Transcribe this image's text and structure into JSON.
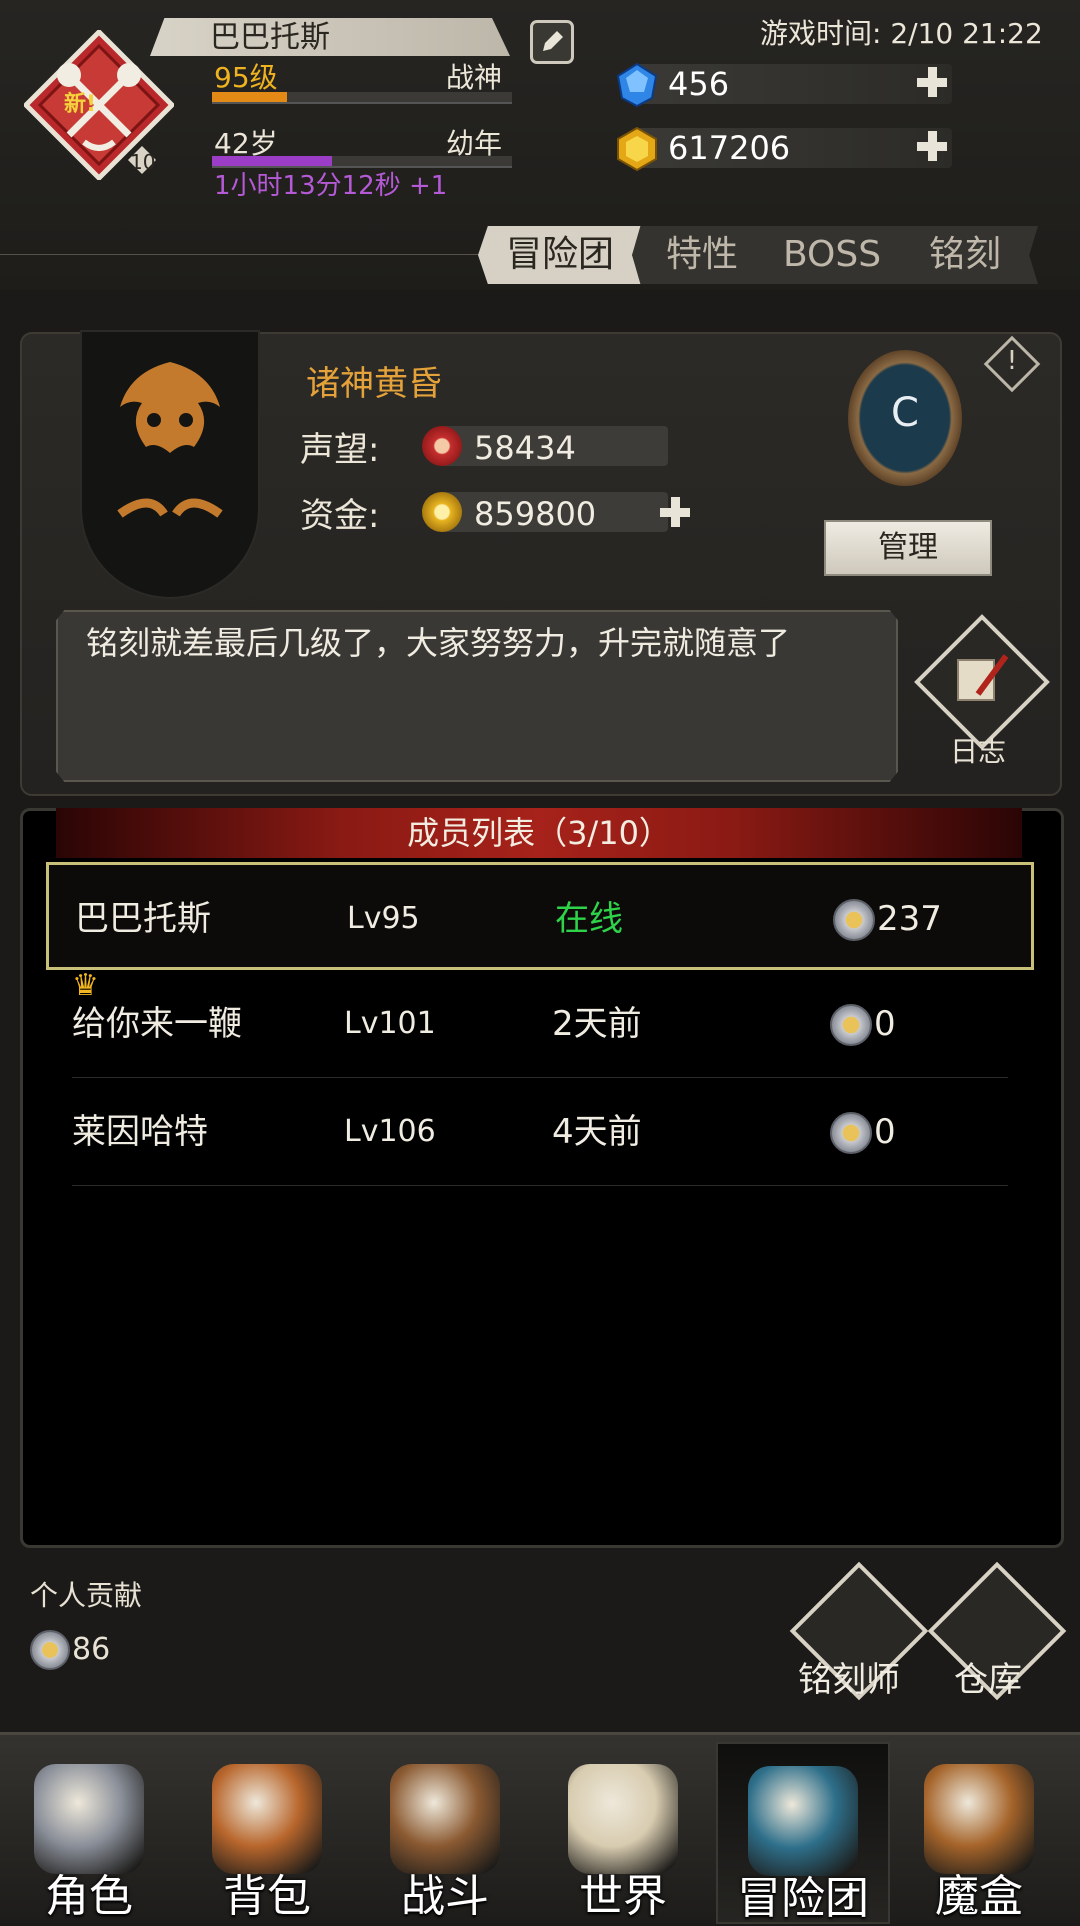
{
  "player": {
    "name": "巴巴托斯",
    "level_text": "95级",
    "title": "战神",
    "level_progress": 0.25,
    "age_text": "42岁",
    "age_stage": "幼年",
    "age_progress": 0.4,
    "age_timer": "1小时13分12秒 +1",
    "badge_new": "新!",
    "badge_level": "10"
  },
  "game_time": "游戏时间: 2/10 21:22",
  "currency": {
    "gems": "456",
    "gold": "617206"
  },
  "tabs": [
    {
      "label": "冒险团",
      "active": true
    },
    {
      "label": "特性",
      "active": false
    },
    {
      "label": "BOSS",
      "active": false
    },
    {
      "label": "铭刻",
      "active": false
    }
  ],
  "guild": {
    "name": "诸神黄昏",
    "reputation_label": "声望:",
    "reputation": "58434",
    "funds_label": "资金:",
    "funds": "859800",
    "rank": "C",
    "manage_label": "管理",
    "notice": "铭刻就差最后几级了，大家努努力，升完就随意了",
    "log_label": "日志",
    "info_mark": "!"
  },
  "member_list": {
    "title": "成员列表（3/10）",
    "members": [
      {
        "name": "巴巴托斯",
        "level": "Lv95",
        "status": "在线",
        "contribution": "237",
        "online": true,
        "leader": false
      },
      {
        "name": "给你来一鞭",
        "level": "Lv101",
        "status": "2天前",
        "contribution": "0",
        "online": false,
        "leader": true
      },
      {
        "name": "莱因哈特",
        "level": "Lv106",
        "status": "4天前",
        "contribution": "0",
        "online": false,
        "leader": false
      }
    ]
  },
  "personal": {
    "label": "个人贡献",
    "value": "86"
  },
  "actions": [
    {
      "label": "铭刻师"
    },
    {
      "label": "仓库"
    }
  ],
  "nav": [
    {
      "label": "角色",
      "icon": "helmet-icon"
    },
    {
      "label": "背包",
      "icon": "backpack-icon"
    },
    {
      "label": "战斗",
      "icon": "sword-shield-icon"
    },
    {
      "label": "世界",
      "icon": "scroll-map-icon"
    },
    {
      "label": "冒险团",
      "icon": "castle-icon",
      "active": true
    },
    {
      "label": "魔盒",
      "icon": "magic-box-icon"
    }
  ],
  "colors": {
    "accent_gold": "#e5a23a",
    "online_green": "#2fd34a",
    "timer_purple": "#b45ad6",
    "header_red": "#a6221a"
  }
}
